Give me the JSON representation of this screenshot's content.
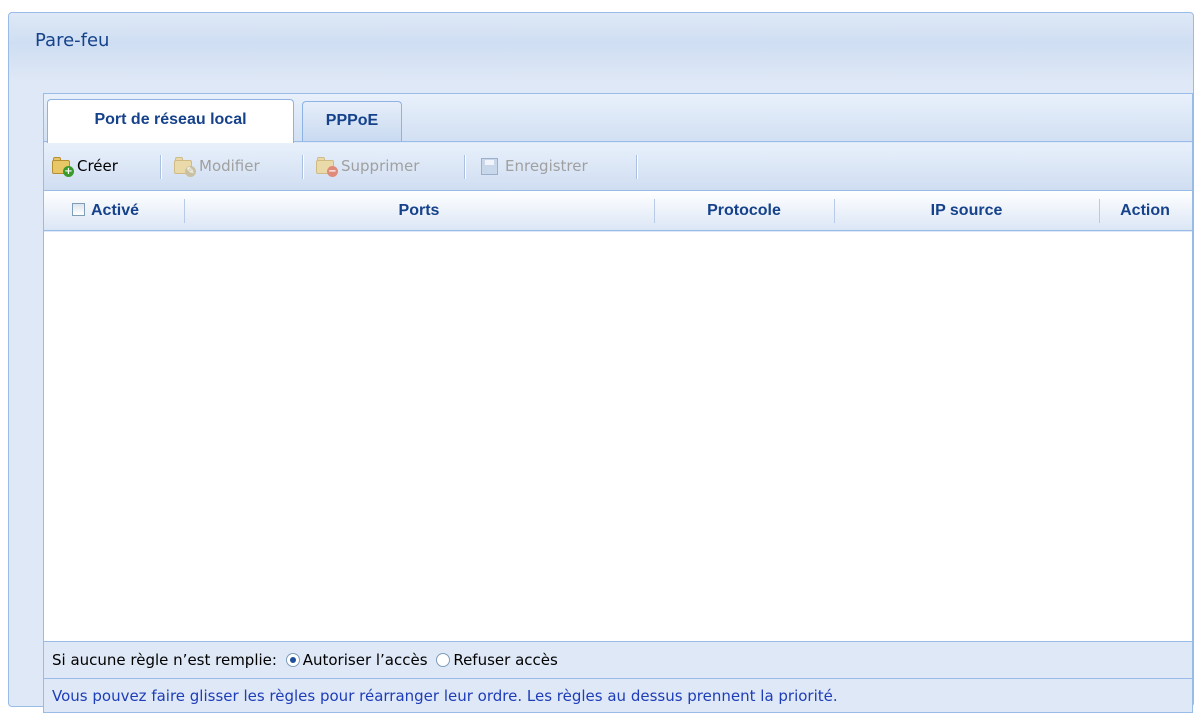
{
  "panel": {
    "title": "Pare-feu"
  },
  "tabs": [
    {
      "label": "Port de réseau local",
      "active": true
    },
    {
      "label": "PPPoE",
      "active": false
    }
  ],
  "toolbar": {
    "create": {
      "label": "Créer",
      "icon": "folder-add-icon",
      "enabled": true
    },
    "modify": {
      "label": "Modifier",
      "icon": "edit-icon",
      "enabled": false
    },
    "delete": {
      "label": "Supprimer",
      "icon": "folder-delete-icon",
      "enabled": false
    },
    "save": {
      "label": "Enregistrer",
      "icon": "save-icon",
      "enabled": false
    }
  },
  "grid": {
    "columns": [
      "Activé",
      "Ports",
      "Protocole",
      "IP source",
      "Action"
    ],
    "rows": []
  },
  "default_rule": {
    "label": "Si aucune règle n’est remplie:",
    "options": [
      {
        "label": "Autoriser l’accès",
        "checked": true
      },
      {
        "label": "Refuser accès",
        "checked": false
      }
    ]
  },
  "hint": "Vous pouvez faire glisser les règles pour réarranger leur ordre. Les règles au dessus prennent la priorité.",
  "colors": {
    "title": "#15428b",
    "hint": "#1e3db8",
    "border": "#99bbe8"
  }
}
